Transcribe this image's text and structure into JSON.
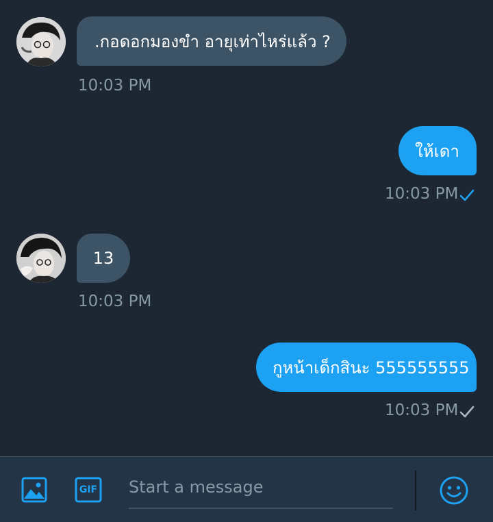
{
  "thread": {
    "messages": [
      {
        "direction": "incoming",
        "text": ".กอดอกมองขำ อายุเท่าไหร่แล้ว ?",
        "time": "10:03 PM"
      },
      {
        "direction": "outgoing",
        "text": "ให้เดา",
        "time": "10:03 PM",
        "status": "read"
      },
      {
        "direction": "incoming",
        "text": "13",
        "time": "10:03 PM"
      },
      {
        "direction": "outgoing",
        "text": "กูหน้าเด็กสินะ 555555555",
        "time": "10:03 PM",
        "status": "sent"
      }
    ]
  },
  "composer": {
    "placeholder": "Start a message",
    "gif_label": "GIF",
    "icons": {
      "image": "image-icon",
      "gif": "gif-icon",
      "emoji": "emoji-icon"
    }
  },
  "colors": {
    "background": "#1c2733",
    "incoming_bubble": "#3d5466",
    "outgoing_bubble": "#1da1f2",
    "timestamp": "#8899a6",
    "read_check": "#1da1f2",
    "sent_check": "#aab8c2",
    "composer": "#243447"
  }
}
